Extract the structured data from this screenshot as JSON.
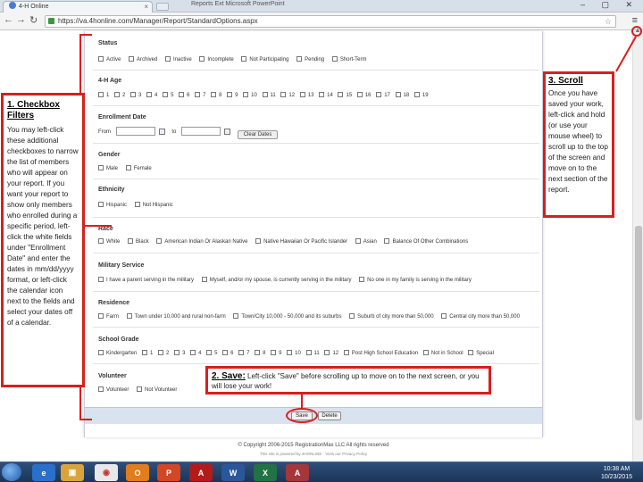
{
  "browser": {
    "tab_title": "4-H Online",
    "user_label": "Reports Ext   Microsoft PowerPoint",
    "url": "https://va.4honline.com/Manager/Report/StandardOptions.aspx",
    "window_controls": "–  ▢  ✕"
  },
  "form": {
    "status": {
      "title": "Status",
      "options": [
        "Active",
        "Archived",
        "Inactive",
        "Incomplete",
        "Not Participating",
        "Pending",
        "Short-Term"
      ]
    },
    "age": {
      "title": "4-H Age",
      "options": [
        "1",
        "2",
        "3",
        "4",
        "5",
        "6",
        "7",
        "8",
        "9",
        "10",
        "11",
        "12",
        "13",
        "14",
        "15",
        "16",
        "17",
        "18",
        "19"
      ]
    },
    "enrollment": {
      "title": "Enrollment Date",
      "from_label": "From",
      "to_label": "to",
      "clear_label": "Clear Dates"
    },
    "gender": {
      "title": "Gender",
      "options": [
        "Male",
        "Female"
      ]
    },
    "ethnicity": {
      "title": "Ethnicity",
      "options": [
        "Hispanic",
        "Not Hispanic"
      ]
    },
    "race": {
      "title": "Race",
      "options": [
        "White",
        "Black",
        "American Indian Or Alaskan Native",
        "Native Hawaiian Or Pacific Islander",
        "Asian",
        "Balance Of Other Combinations"
      ]
    },
    "military": {
      "title": "Military Service",
      "options": [
        "I have a parent serving in the military",
        "Myself, and/or my spouse, is currently serving in the military",
        "No one in my family is serving in the military"
      ]
    },
    "residence": {
      "title": "Residence",
      "options": [
        "Farm",
        "Town under 10,000 and rural non-farm",
        "Town/City 10,000 - 50,000 and its suburbs",
        "Suburb of city more than 50,000",
        "Central city more than 50,000"
      ]
    },
    "grade": {
      "title": "School Grade",
      "options": [
        "Kindergarten",
        "1",
        "2",
        "3",
        "4",
        "5",
        "6",
        "7",
        "8",
        "9",
        "10",
        "11",
        "12",
        "Post High School Education",
        "Not in School",
        "Special"
      ]
    },
    "volunteer": {
      "title": "Volunteer",
      "options": [
        "Volunteer",
        "Not Volunteer"
      ]
    },
    "save_label": "Save",
    "delete_label": "Delete",
    "copyright": "© Copyright 2006-2015 RegistrationMax LLC All rights reserved",
    "copyright_small": "This site is powered by 4HONLINE  ·  View our Privacy Policy"
  },
  "callouts": {
    "checkbox": {
      "title": "1. Checkbox Filters",
      "body": "You may left-click these additional checkboxes to narrow the list of members who will appear on your report. If you want your report to show only members who enrolled during a specific period, left-click the white fields under \"Enrollment Date\" and enter the dates in mm/dd/yyyy format, or left-click the calendar icon next to the fields and select your dates off of a calendar."
    },
    "save": {
      "title": "2. Save:",
      "body": " Left-click \"Save\" before scrolling up to move on to the next screen, or you will lose your work!"
    },
    "scroll": {
      "title": "3. Scroll",
      "body": "Once you have saved your work, left-click and hold (or use your mouse wheel) to scroll up to the top of the screen and move on to the next section of the report."
    },
    "accent_color": "#d81f1f"
  },
  "taskbar": {
    "time": "10:38 AM",
    "date": "10/23/2015",
    "apps": [
      "ie",
      "explorer",
      "chrome",
      "outlook",
      "powerpoint",
      "acrobat",
      "word",
      "excel",
      "access"
    ]
  }
}
